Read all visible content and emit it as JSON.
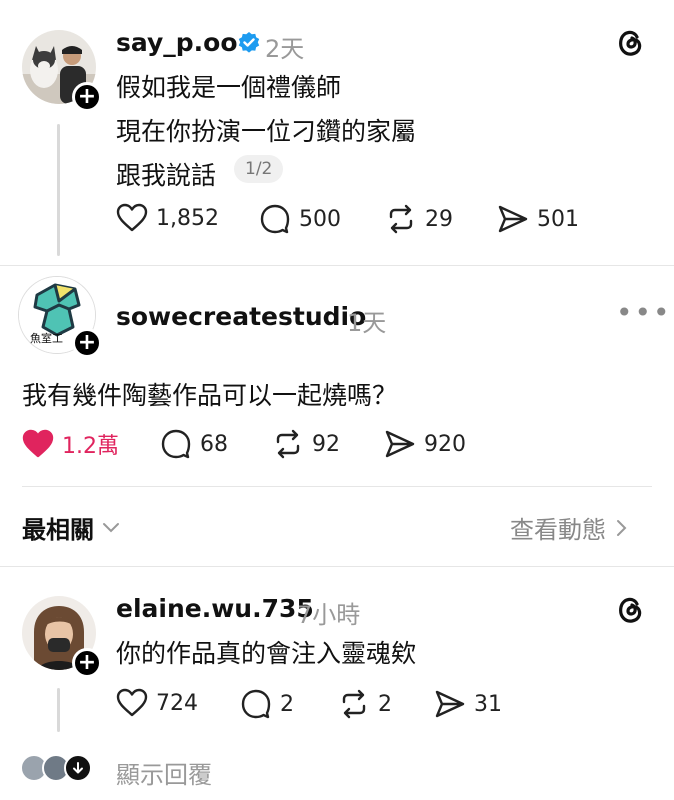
{
  "post1": {
    "username": "say_p.oo",
    "time": "2天",
    "lines": [
      "假如我是一個禮儀師",
      "現在你扮演一位刁鑽的家屬",
      "跟我說話"
    ],
    "page_indicator": "1/2",
    "likes": "1,852",
    "replies": "500",
    "reposts": "29",
    "shares": "501"
  },
  "post2": {
    "username": "sowecreatestudio",
    "time": "1天",
    "avatar_text": "魚室工",
    "text": "我有幾件陶藝作品可以一起燒嗎？",
    "likes": "1.2萬",
    "replies": "68",
    "reposts": "92",
    "shares": "920"
  },
  "sort": {
    "label": "最相關",
    "activity_link": "查看動態"
  },
  "post3": {
    "username": "elaine.wu.735",
    "time": "7小時",
    "text": "你的作品真的會注入靈魂欸",
    "likes": "724",
    "replies": "2",
    "reposts": "2",
    "shares": "31"
  },
  "show_replies": "顯示回覆",
  "colors": {
    "like_active": "#e0245e",
    "verified": "#1d9bf0",
    "muted": "#999999"
  }
}
